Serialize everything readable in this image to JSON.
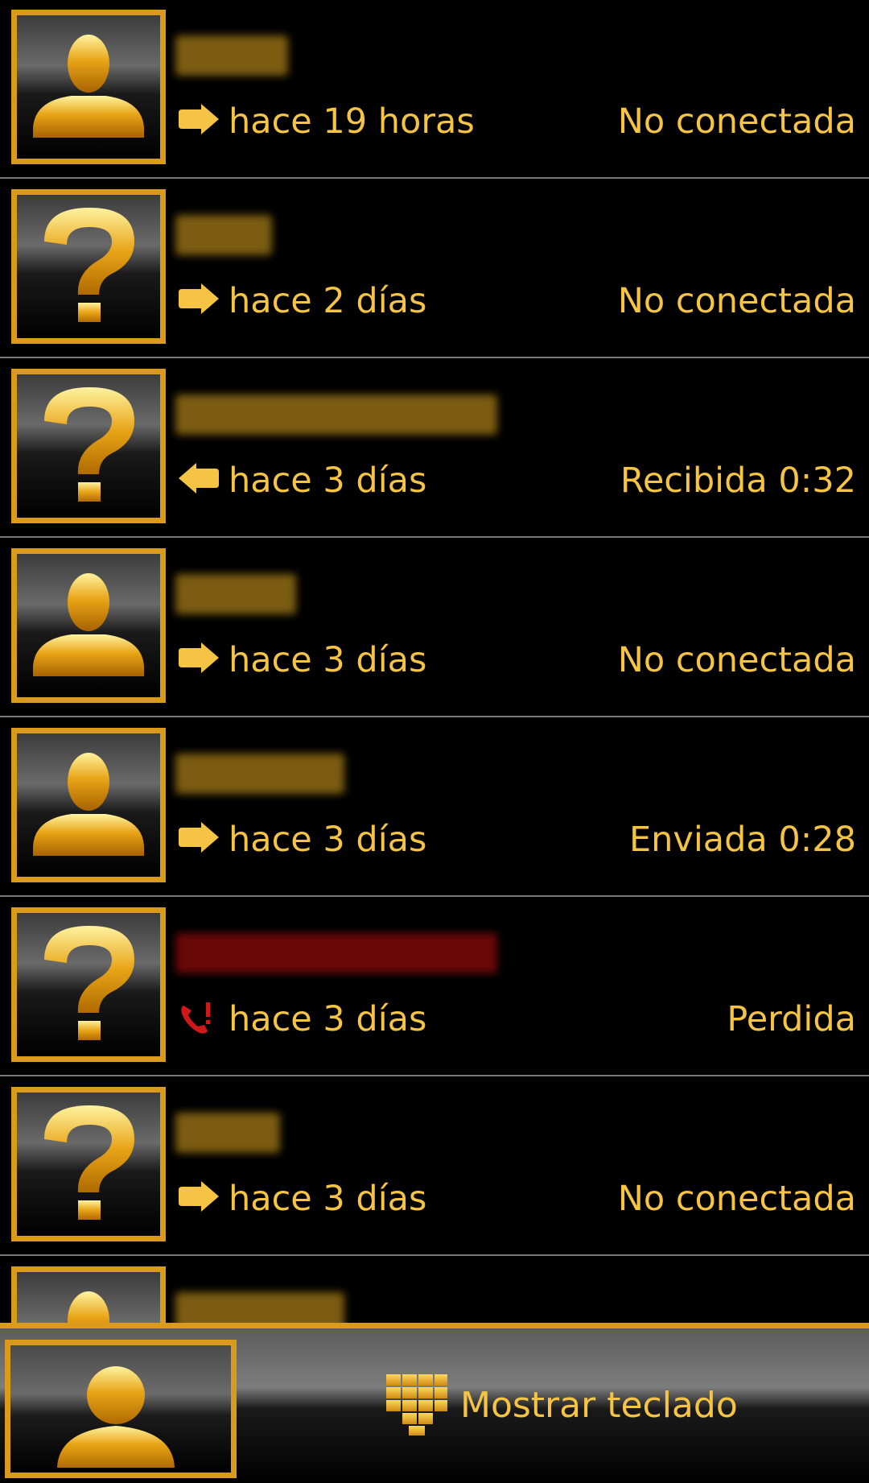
{
  "colors": {
    "accent_gold": "#f6c444",
    "frame_gold": "#d99a1d",
    "missed_red": "#d01818",
    "divider": "#7a7a7a"
  },
  "calls": [
    {
      "avatar": "person-icon",
      "direction": "outgoing-arrow-icon",
      "when": "hace 19 horas",
      "status": "No conectada",
      "name_color": "#e0a820"
    },
    {
      "avatar": "question-mark-icon",
      "direction": "outgoing-arrow-icon",
      "when": "hace 2 días",
      "status": "No conectada",
      "name_color": "#e0a820"
    },
    {
      "avatar": "question-mark-icon",
      "direction": "incoming-arrow-icon",
      "when": "hace 3 días",
      "status": "Recibida 0:32",
      "name_color": "#e0a820"
    },
    {
      "avatar": "person-icon",
      "direction": "outgoing-arrow-icon",
      "when": "hace 3 días",
      "status": "No conectada",
      "name_color": "#e0a820"
    },
    {
      "avatar": "person-icon",
      "direction": "outgoing-arrow-icon",
      "when": "hace 3 días",
      "status": "Enviada 0:28",
      "name_color": "#e0a820"
    },
    {
      "avatar": "question-mark-icon",
      "direction": "missed-call-icon",
      "when": "hace 3 días",
      "status": "Perdida",
      "name_color": "#c01010"
    },
    {
      "avatar": "question-mark-icon",
      "direction": "outgoing-arrow-icon",
      "when": "hace 3 días",
      "status": "No conectada",
      "name_color": "#e0a820"
    },
    {
      "avatar": "person-icon",
      "direction": "",
      "when": "",
      "status": "",
      "name_color": "#e0a820"
    }
  ],
  "bottom_bar": {
    "avatar": "person-icon",
    "keypad_icon": "keypad-icon",
    "keypad_label": "Mostrar teclado"
  }
}
